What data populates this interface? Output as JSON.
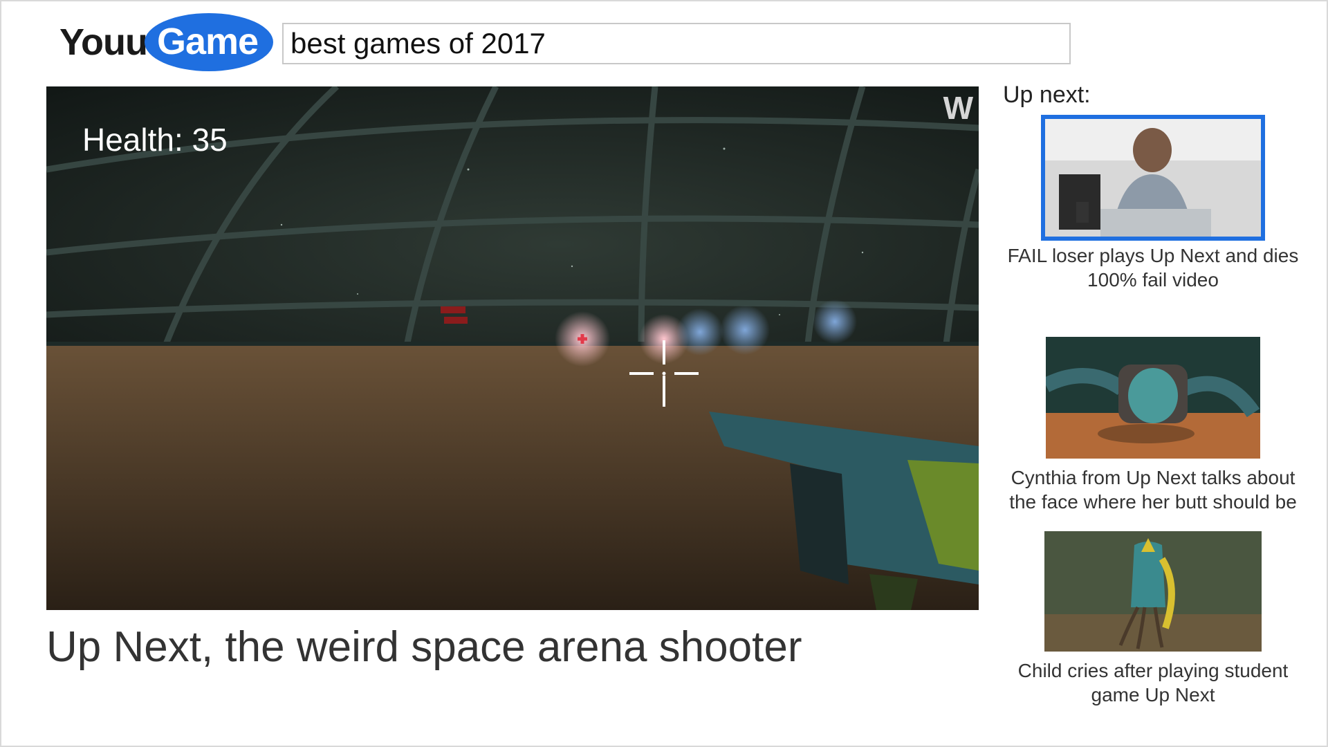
{
  "site": {
    "logo_part1": "Youu",
    "logo_part2": "Game"
  },
  "search": {
    "value": "best games of 2017"
  },
  "player": {
    "health_text": "Health: 35",
    "watermark": "W"
  },
  "video": {
    "title": "Up Next, the weird space arena shooter"
  },
  "sidebar": {
    "heading": "Up next:",
    "items": [
      {
        "title": "FAIL loser plays Up Next and dies 100% fail video",
        "thumbnail": "person-at-laptop",
        "selected": true
      },
      {
        "title": "Cynthia from Up Next talks about the face where her butt should be",
        "thumbnail": "stone-face-creature"
      },
      {
        "title": "Child cries after playing student game Up Next",
        "thumbnail": "tentacle-creature"
      }
    ]
  },
  "colors": {
    "brand": "#1f6fe0",
    "text": "#333333"
  }
}
